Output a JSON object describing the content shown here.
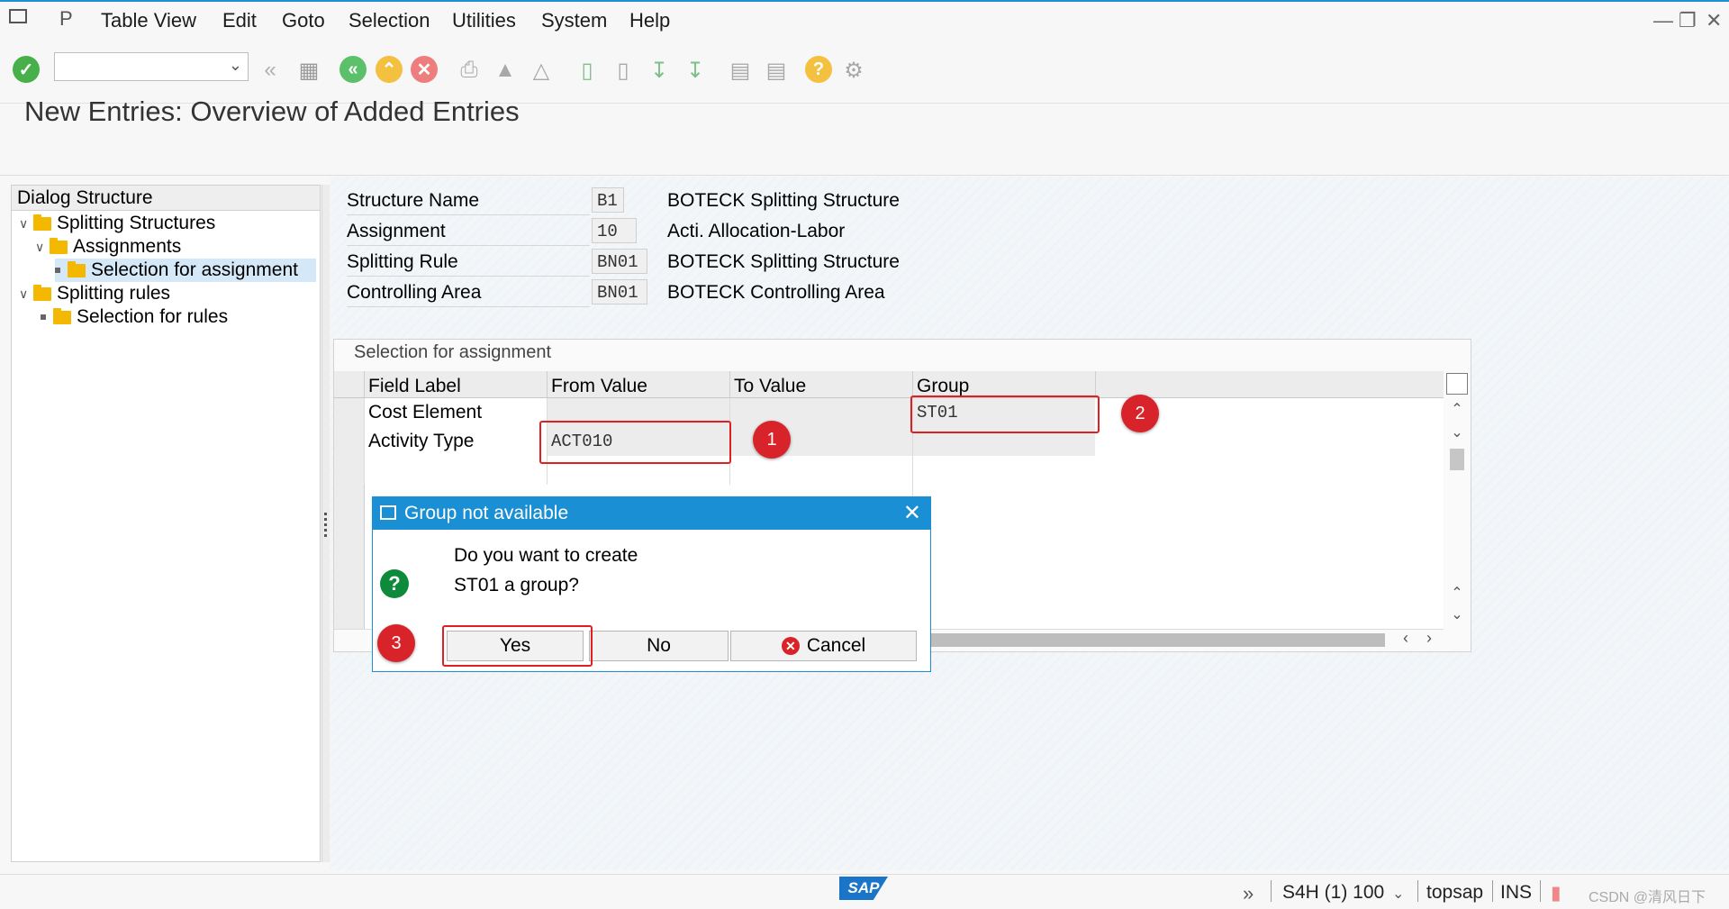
{
  "menu": {
    "items": [
      "Table View",
      "Edit",
      "Goto",
      "Selection",
      "Utilities",
      "System",
      "Help"
    ]
  },
  "toolbar": {
    "command_field": "",
    "icons": [
      "enter-icon",
      "back-double-icon",
      "save-icon",
      "back-icon",
      "exit-icon",
      "cancel-icon",
      "print-icon",
      "find-icon",
      "find-next-icon",
      "first-page-icon",
      "prev-page-icon",
      "next-page-icon",
      "last-page-icon",
      "create-session-icon",
      "shortcut-icon",
      "help-icon",
      "settings-icon"
    ]
  },
  "page": {
    "title": "New Entries: Overview of Added Entries"
  },
  "dialog_structure": {
    "header": "Dialog Structure",
    "items": [
      {
        "label": "Splitting Structures",
        "level": 0,
        "expanded": true
      },
      {
        "label": "Assignments",
        "level": 1,
        "expanded": true
      },
      {
        "label": "Selection for assignment",
        "level": 2,
        "selected": true
      },
      {
        "label": "Splitting rules",
        "level": 0,
        "expanded": true
      },
      {
        "label": "Selection for rules",
        "level": 1
      }
    ]
  },
  "header_fields": [
    {
      "label": "Structure Name",
      "value": "B1",
      "desc": "BOTECK  Splitting Structure"
    },
    {
      "label": "Assignment",
      "value": "10",
      "desc": "Acti. Allocation-Labor"
    },
    {
      "label": "Splitting Rule",
      "value": "BN01",
      "desc": "BOTECK Splitting Structure"
    },
    {
      "label": "Controlling Area",
      "value": "BN01",
      "desc": "BOTECK Controlling Area"
    }
  ],
  "table": {
    "caption": "Selection for assignment",
    "columns": [
      "Field Label",
      "From Value",
      "To Value",
      "Group"
    ],
    "rows": [
      {
        "field_label": "Cost Element",
        "from": "",
        "to": "",
        "group": "ST01"
      },
      {
        "field_label": "Activity Type",
        "from": "ACT010",
        "to": "",
        "group": ""
      }
    ]
  },
  "annotations": [
    "1",
    "2",
    "3"
  ],
  "dialog": {
    "title": "Group not available",
    "message_line1": "Do you want to create",
    "message_line2": "ST01 a group?",
    "yes": "Yes",
    "no": "No",
    "cancel": "Cancel"
  },
  "status": {
    "system": "S4H (1) 100",
    "server": "topsap",
    "mode": "INS",
    "watermark": "CSDN @清风日下"
  },
  "colors": {
    "accent": "#1a8fd3",
    "annotation": "#d9232a",
    "question": "#0e8a3d"
  }
}
